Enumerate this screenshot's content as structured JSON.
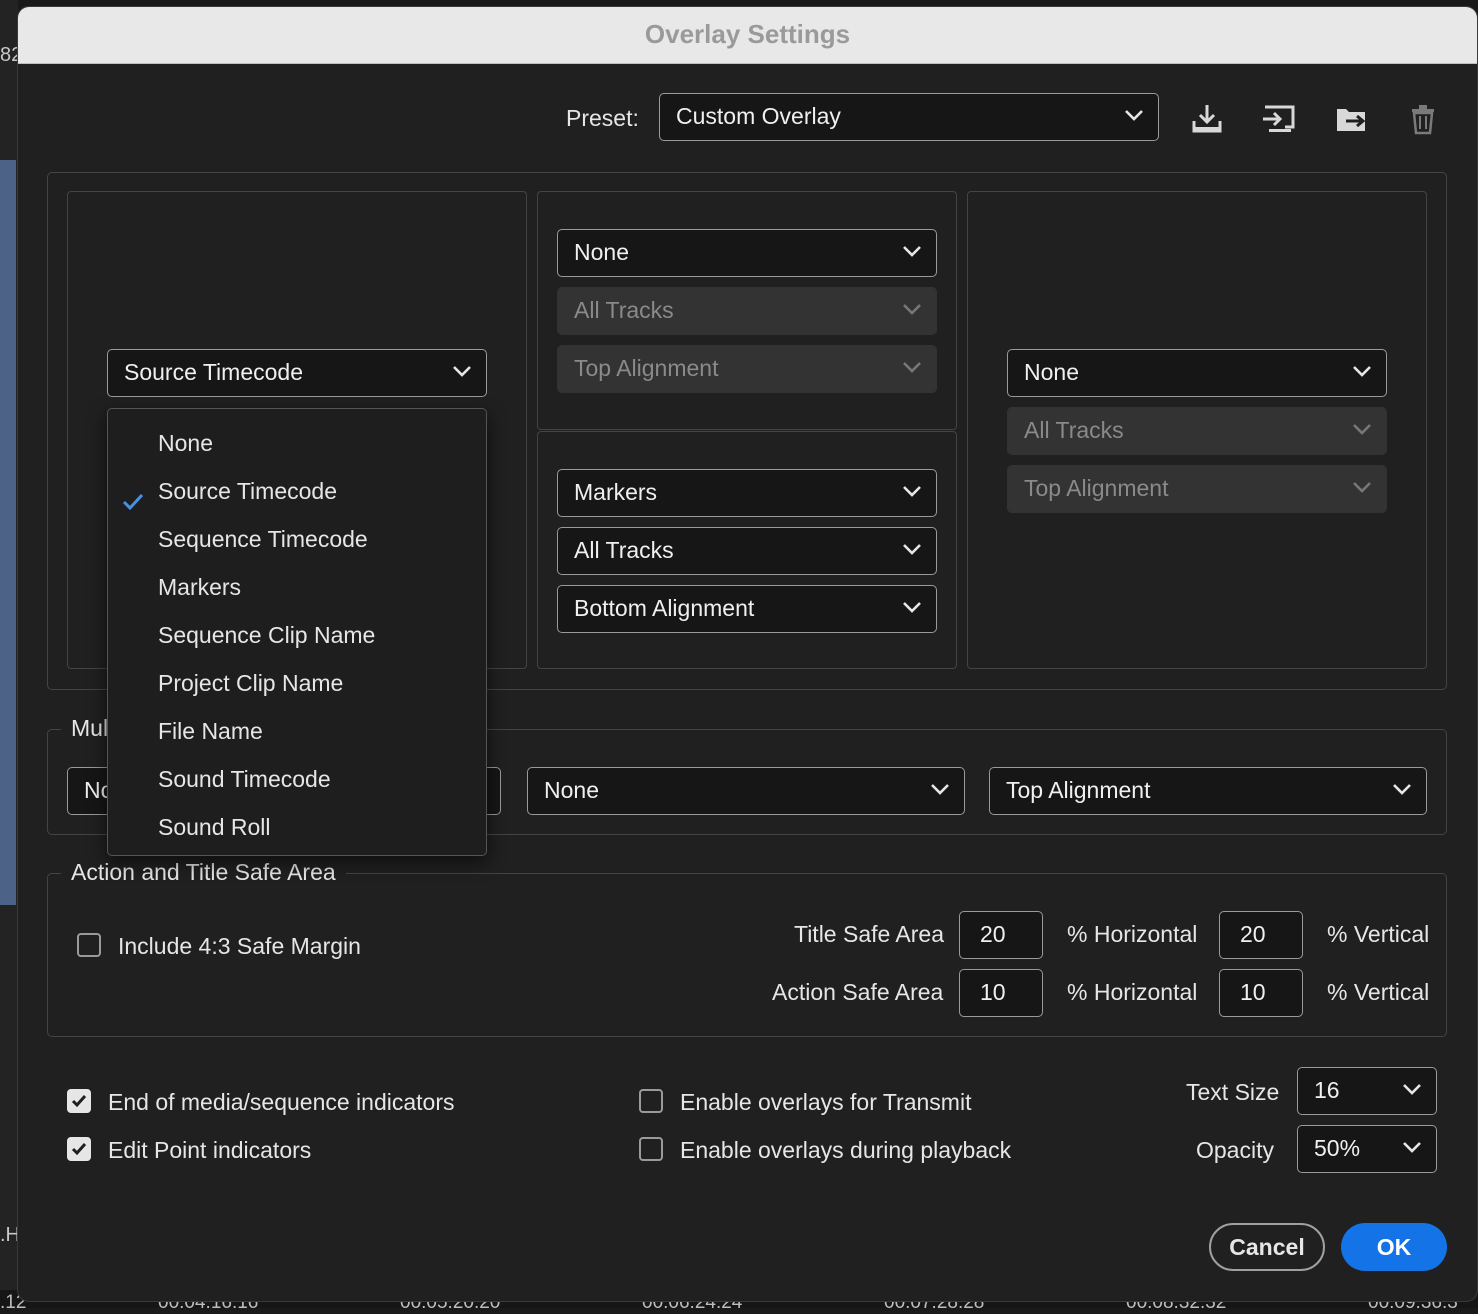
{
  "background": {
    "left_fragment_top": "82",
    "left_fragment_bottom": ".H",
    "timecodes": [
      ".12",
      "00:04:16:16",
      "00:05:20:20",
      "00:06:24:24",
      "00:07:28:28",
      "00:08:32:32",
      "00:09:36:3"
    ]
  },
  "dialog": {
    "title": "Overlay Settings",
    "preset_label": "Preset:",
    "preset_value": "Custom Overlay",
    "toolbar_icons": [
      "save-preset-icon",
      "import-preset-icon",
      "export-preset-icon",
      "trash-icon"
    ]
  },
  "panels": {
    "left": {
      "overlay": "Source Timecode"
    },
    "top_center": {
      "overlay": "None",
      "tracks": "All Tracks",
      "alignment": "Top Alignment"
    },
    "bottom_center": {
      "overlay": "Markers",
      "tracks": "All Tracks",
      "alignment": "Bottom Alignment"
    },
    "right": {
      "overlay": "None",
      "tracks": "All Tracks",
      "alignment": "Top Alignment"
    }
  },
  "dropdown_menu": {
    "items": [
      "None",
      "Source Timecode",
      "Sequence Timecode",
      "Markers",
      "Sequence Clip Name",
      "Project Clip Name",
      "File Name",
      "Sound Timecode",
      "Sound Roll"
    ],
    "selected": "Source Timecode"
  },
  "multicam": {
    "legend_partial": "Mul",
    "left_partial": "No",
    "center": "None",
    "right": "Top Alignment"
  },
  "safe_area": {
    "legend": "Action and Title Safe Area",
    "include_margin_label": "Include 4:3 Safe Margin",
    "include_margin_checked": false,
    "title_label": "Title Safe Area",
    "title_h": "20",
    "title_v": "20",
    "action_label": "Action Safe Area",
    "action_h": "10",
    "action_v": "10",
    "pct_h": "% Horizontal",
    "pct_v": "% Vertical"
  },
  "options": {
    "end_media_label": "End of media/sequence indicators",
    "end_media_checked": true,
    "edit_point_label": "Edit Point indicators",
    "edit_point_checked": true,
    "transmit_label": "Enable overlays for Transmit",
    "transmit_checked": false,
    "playback_label": "Enable overlays during playback",
    "playback_checked": false,
    "text_size_label": "Text Size",
    "text_size_value": "16",
    "opacity_label": "Opacity",
    "opacity_value": "50%"
  },
  "buttons": {
    "cancel": "Cancel",
    "ok": "OK"
  },
  "colors": {
    "accent": "#1473e6",
    "check": "#4a90e2"
  }
}
